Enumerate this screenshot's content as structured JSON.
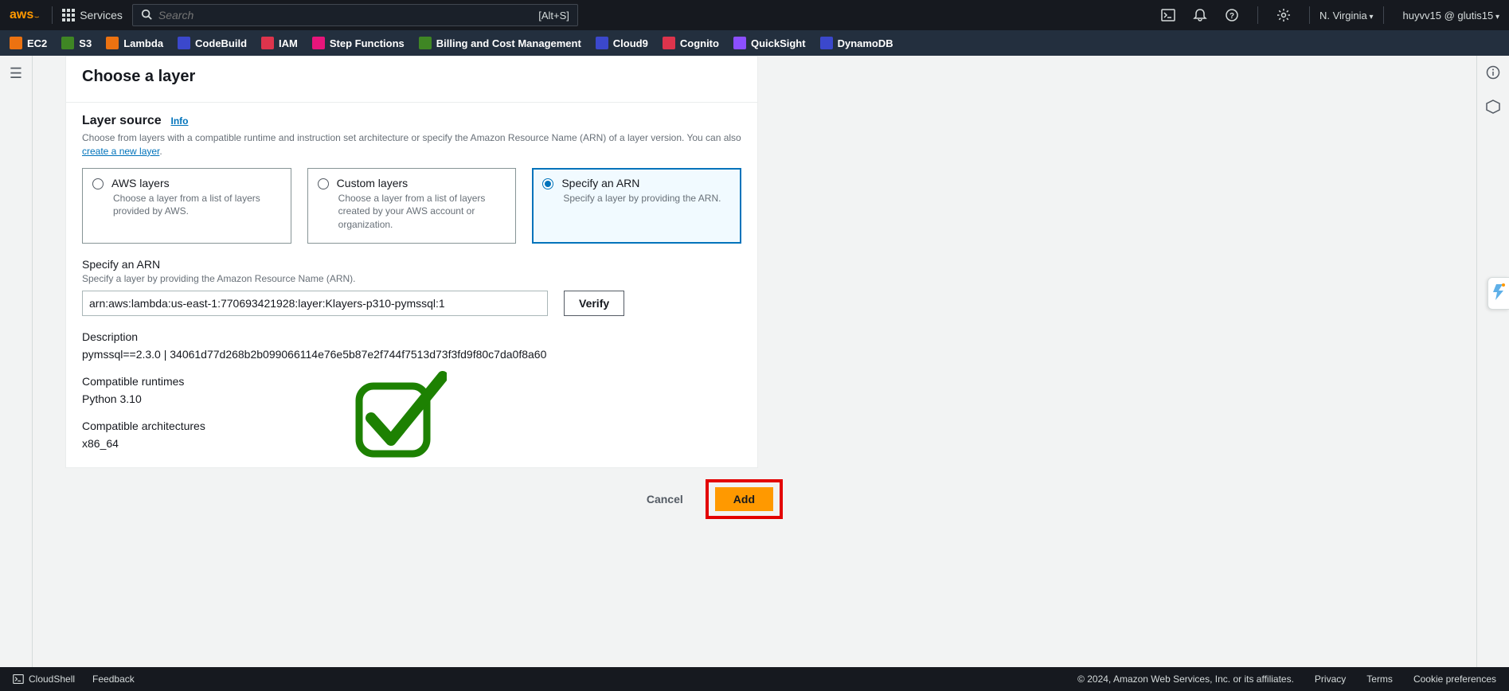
{
  "header": {
    "logo_text": "aws",
    "services_label": "Services",
    "search_placeholder": "Search",
    "search_shortcut": "[Alt+S]",
    "region": "N. Virginia",
    "user": "huyvv15 @ glutis15"
  },
  "service_bar": [
    {
      "name": "EC2",
      "color": "#ec7211"
    },
    {
      "name": "S3",
      "color": "#3f8624"
    },
    {
      "name": "Lambda",
      "color": "#ec7211"
    },
    {
      "name": "CodeBuild",
      "color": "#3b48cc"
    },
    {
      "name": "IAM",
      "color": "#dd344c"
    },
    {
      "name": "Step Functions",
      "color": "#e7157b"
    },
    {
      "name": "Billing and Cost Management",
      "color": "#3f8624"
    },
    {
      "name": "Cloud9",
      "color": "#3b48cc"
    },
    {
      "name": "Cognito",
      "color": "#dd344c"
    },
    {
      "name": "QuickSight",
      "color": "#8c4fff"
    },
    {
      "name": "DynamoDB",
      "color": "#3b48cc"
    }
  ],
  "page": {
    "title": "Choose a layer",
    "section_title": "Layer source",
    "info_link": "Info",
    "subtext_1": "Choose from layers with a compatible runtime and instruction set architecture or specify the Amazon Resource Name (ARN) of a layer version. You can also ",
    "subtext_link": "create a new layer",
    "options": [
      {
        "title": "AWS layers",
        "desc": "Choose a layer from a list of layers provided by AWS."
      },
      {
        "title": "Custom layers",
        "desc": "Choose a layer from a list of layers created by your AWS account or organization."
      },
      {
        "title": "Specify an ARN",
        "desc": "Specify a layer by providing the ARN."
      }
    ],
    "arn_label": "Specify an ARN",
    "arn_sub": "Specify a layer by providing the Amazon Resource Name (ARN).",
    "arn_value": "arn:aws:lambda:us-east-1:770693421928:layer:Klayers-p310-pymssql:1",
    "verify_label": "Verify",
    "desc_label": "Description",
    "desc_value": "pymssql==2.3.0 | 34061d77d268b2b099066114e76e5b87e2f744f7513d73f3fd9f80c7da0f8a60",
    "runtimes_label": "Compatible runtimes",
    "runtimes_value": "Python 3.10",
    "arch_label": "Compatible architectures",
    "arch_value": "x86_64",
    "cancel_label": "Cancel",
    "add_label": "Add"
  },
  "footer": {
    "cloudshell": "CloudShell",
    "feedback": "Feedback",
    "copyright": "© 2024, Amazon Web Services, Inc. or its affiliates.",
    "privacy": "Privacy",
    "terms": "Terms",
    "cookies": "Cookie preferences"
  }
}
